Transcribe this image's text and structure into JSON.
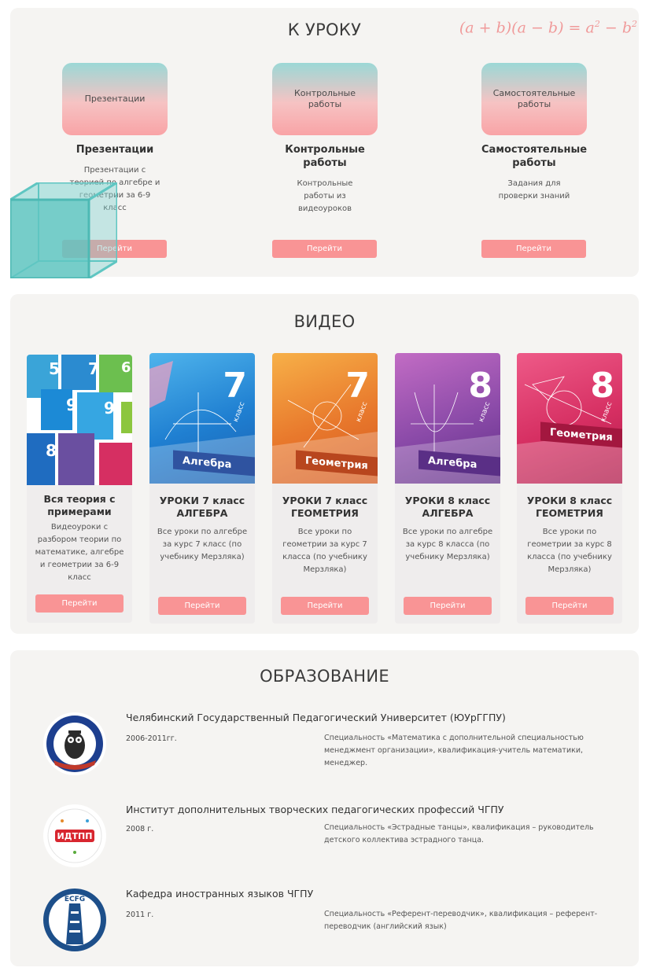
{
  "lesson_section": {
    "title": "К УРОКУ",
    "formula": "(a + b)(a − b) = a² − b²",
    "cards": [
      {
        "thumb": "Презентации",
        "name": "Презентации",
        "desc": "Презентации с теорией по алгебре и геометрии за 6-9 класс",
        "button": "Перейти"
      },
      {
        "thumb": "Контрольные работы",
        "name": "Контрольные работы",
        "desc": "Контрольные работы из видеоуроков",
        "button": "Перейти"
      },
      {
        "thumb": "Самостоятельные работы",
        "name": "Самостоятельные работы",
        "desc": "Задания для проверки знаний",
        "button": "Перейти"
      }
    ]
  },
  "video_section": {
    "title": "ВИДЕО",
    "cards": [
      {
        "name": "Вся теория с примерами",
        "desc": "Видеоуроки с разбором теории по математике, алгебре и геометрии за 6-9 класс",
        "button": "Перейти"
      },
      {
        "name": "УРОКИ 7 класс АЛГЕБРА",
        "desc": "Все уроки по алгебре за курс 7 класс (по учебнику Мерзляка)",
        "button": "Перейти",
        "cover_num": "7",
        "cover_title": "Алгебра",
        "cover_klass": "класс"
      },
      {
        "name": "УРОКИ 7 класс ГЕОМЕТРИЯ",
        "desc": "Все уроки по геометрии за курс 7 класса (по учебнику Мерзляка)",
        "button": "Перейти",
        "cover_num": "7",
        "cover_title": "Геометрия",
        "cover_klass": "класс"
      },
      {
        "name": "УРОКИ 8 класс АЛГЕБРА",
        "desc": "Все уроки по алгебре за курс 8 класса (по учебнику Мерзляка)",
        "button": "Перейти",
        "cover_num": "8",
        "cover_title": "Алгебра",
        "cover_klass": "класс"
      },
      {
        "name": "УРОКИ 8 класс ГЕОМЕТРИЯ",
        "desc": "Все уроки по геометрии за курс 8 класса (по учебнику Мерзляка)",
        "button": "Перейти",
        "cover_num": "8",
        "cover_title": "Геометрия",
        "cover_klass": "класс"
      }
    ],
    "collage_numbers": [
      "5",
      "7",
      "6",
      "9",
      "9",
      "8"
    ]
  },
  "education_section": {
    "title": "ОБРАЗОВАНИЕ",
    "items": [
      {
        "title": "Челябинский Государственный Педагогический Университет (ЮУрГГПУ)",
        "years": "2006-2011гг.",
        "spec": "Специальность «Математика с дополнительной специальностью менеджмент организации», квалификация-учитель математики, менеджер.",
        "logo": "owl-university-emblem"
      },
      {
        "title": "Институт дополнительных творческих педагогических профессий ЧГПУ",
        "years": "2008 г.",
        "spec": "Специальность «Эстрадные танцы», квалификация – руководитель детского коллектива эстрадного танца.",
        "logo": "idtpp-emblem",
        "logo_text": "ИДТПП"
      },
      {
        "title": "Кафедра иностранных языков ЧГПУ",
        "years": "2011 г.",
        "spec": "Специальность «Референт-переводчик», квалификация – референт-переводчик (английский язык)",
        "logo": "ecfg-tower-emblem",
        "logo_text": "ЕСFG"
      }
    ]
  },
  "colors": {
    "section_bg": "#f5f4f2",
    "button": "#f99495",
    "accent_teal": "#5fc6c2",
    "algebra7": "#1f7fd1",
    "geometry7": "#e8782c",
    "algebra8": "#7b3f9e",
    "geometry8": "#d62f62"
  }
}
